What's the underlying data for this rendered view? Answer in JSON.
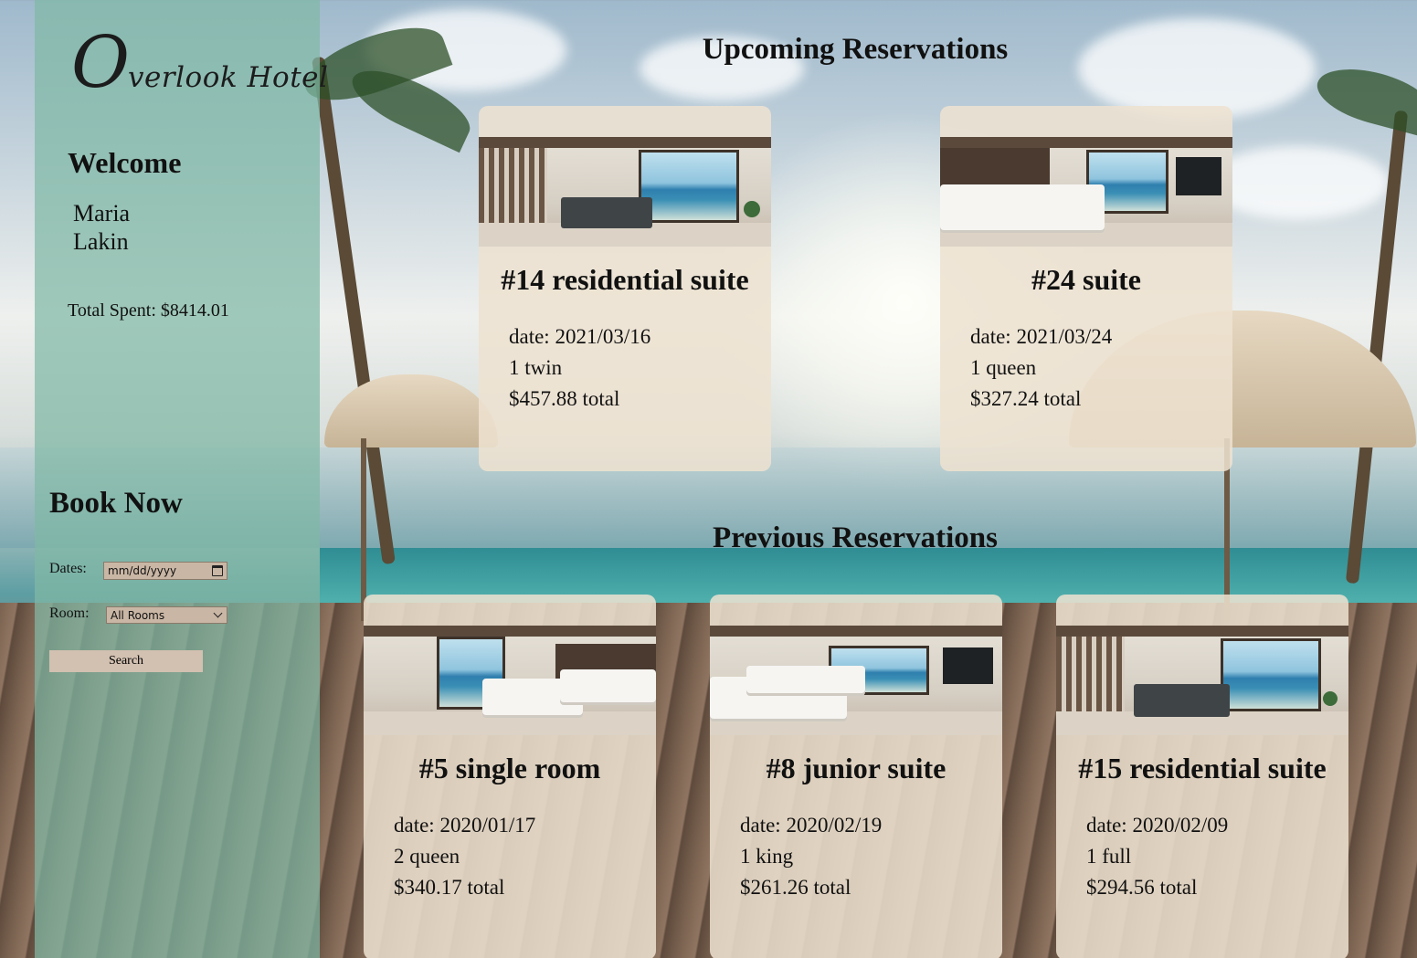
{
  "brand": {
    "logo_initial": "O",
    "logo_rest": "verlook Hotel"
  },
  "user": {
    "welcome": "Welcome",
    "first_name": "Maria",
    "last_name": "Lakin",
    "total_spent_label": "Total Spent: $8414.01"
  },
  "booking": {
    "heading": "Book Now",
    "dates_label": "Dates:",
    "dates_placeholder": "mm/dd/yyyy",
    "room_label": "Room:",
    "room_selected": "All Rooms",
    "search_label": "Search"
  },
  "upcoming": {
    "heading": "Upcoming Reservations",
    "cards": [
      {
        "title": "#14 residential suite",
        "date": "date: 2021/03/16",
        "beds": "1 twin",
        "total": "$457.88 total"
      },
      {
        "title": "#24 suite",
        "date": "date: 2021/03/24",
        "beds": "1 queen",
        "total": "$327.24 total"
      }
    ]
  },
  "previous": {
    "heading": "Previous Reservations",
    "cards": [
      {
        "title": "#5 single room",
        "date": "date: 2020/01/17",
        "beds": "2 queen",
        "total": "$340.17 total"
      },
      {
        "title": "#8 junior suite",
        "date": "date: 2020/02/19",
        "beds": "1 king",
        "total": "$261.26 total"
      },
      {
        "title": "#15 residential suite",
        "date": "date: 2020/02/09",
        "beds": "1 full",
        "total": "$294.56 total"
      }
    ]
  }
}
